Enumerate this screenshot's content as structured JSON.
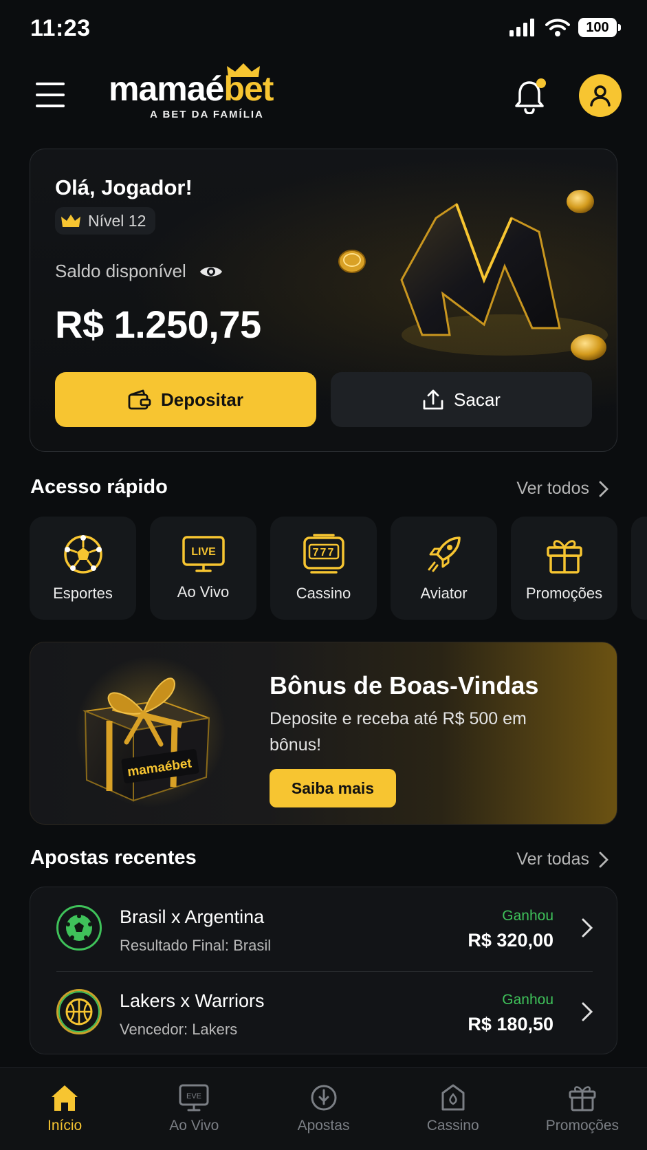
{
  "status_bar": {
    "time": "11:23",
    "battery": "100"
  },
  "header": {
    "logo_word_main": "mamaé",
    "logo_word_accent": "bet",
    "logo_tagline": "A BET DA FAMÍLIA"
  },
  "balance_card": {
    "greeting": "Olá, Jogador!",
    "level": "Nível 12",
    "balance_label": "Saldo disponível",
    "balance_value": "R$ 1.250,75",
    "deposit_label": "Depositar",
    "withdraw_label": "Sacar"
  },
  "quick_access": {
    "title": "Acesso rápido",
    "see_all": "Ver todos",
    "items": [
      {
        "label": "Esportes",
        "icon": "soccer-ball-icon"
      },
      {
        "label": "Ao Vivo",
        "icon": "live-tv-icon",
        "icon_text": "LIVE"
      },
      {
        "label": "Cassino",
        "icon": "slot-machine-icon",
        "icon_text": "777"
      },
      {
        "label": "Aviator",
        "icon": "rocket-icon"
      },
      {
        "label": "Promoções",
        "icon": "gift-icon"
      }
    ]
  },
  "promo": {
    "title": "Bônus de Boas-Vindas",
    "description": "Deposite e receba até R$ 500 em bônus!",
    "button": "Saiba mais",
    "gift_brand": "mamaébet"
  },
  "recent_bets": {
    "title": "Apostas recentes",
    "see_all": "Ver todas",
    "items": [
      {
        "match": "Brasil x Argentina",
        "detail": "Resultado Final: Brasil",
        "status": "Ganhou",
        "amount": "R$ 320,00",
        "icon": "soccer-ball-icon"
      },
      {
        "match": "Lakers x Warriors",
        "detail": "Vencedor: Lakers",
        "status": "Ganhou",
        "amount": "R$ 180,50",
        "icon": "basketball-icon"
      }
    ]
  },
  "bottom_nav": {
    "items": [
      {
        "label": "Início",
        "icon": "home-icon",
        "active": true
      },
      {
        "label": "Ao Vivo",
        "icon": "live-tv-icon",
        "icon_text": "EVE"
      },
      {
        "label": "Apostas",
        "icon": "bet-slip-icon"
      },
      {
        "label": "Cassino",
        "icon": "casino-icon"
      },
      {
        "label": "Promoções",
        "icon": "gift-icon"
      }
    ]
  },
  "colors": {
    "accent": "#f7c531",
    "background": "#0b0d0f",
    "win_green": "#3fc25a"
  }
}
